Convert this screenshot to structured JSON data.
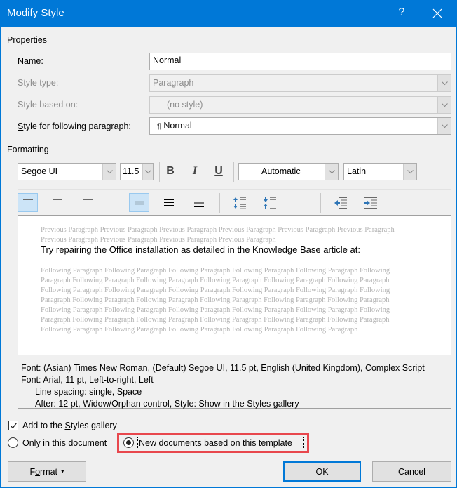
{
  "window": {
    "title": "Modify Style",
    "help_label": "?",
    "close_icon": "close-icon"
  },
  "properties": {
    "group_label": "Properties",
    "name": {
      "label_prefix": "",
      "label_u": "N",
      "label_rest": "ame:",
      "value": "Normal"
    },
    "style_type": {
      "label": "Style type:",
      "value": "Paragraph",
      "disabled": true
    },
    "style_based_on": {
      "label": "Style based on:",
      "value": "(no style)",
      "disabled": true
    },
    "style_following": {
      "label_u": "S",
      "label_rest": "tyle for following paragraph:",
      "icon": "pilcrow-icon",
      "pilcrow": "¶",
      "value": "Normal"
    }
  },
  "formatting": {
    "group_label": "Formatting",
    "font_name": "Segoe UI",
    "font_size": "11.5",
    "bold_label": "B",
    "italic_label": "I",
    "underline_label": "U",
    "color": "Automatic",
    "script": "Latin",
    "alignment": {
      "options": [
        "left",
        "center",
        "right",
        "justify"
      ],
      "selected": "left"
    },
    "line_spacing": {
      "options": [
        "single",
        "one-and-half",
        "double"
      ],
      "selected": "single"
    }
  },
  "preview": {
    "previous_text": "Previous Paragraph Previous Paragraph Previous Paragraph Previous Paragraph Previous Paragraph Previous Paragraph Previous Paragraph Previous Paragraph Previous Paragraph Previous Paragraph",
    "sample_text": "Try repairing the Office installation as detailed in the Knowledge Base article at:",
    "following_text": "Following Paragraph Following Paragraph Following Paragraph Following Paragraph Following Paragraph Following Paragraph Following Paragraph Following Paragraph Following Paragraph Following Paragraph Following Paragraph Following Paragraph Following Paragraph Following Paragraph Following Paragraph Following Paragraph Following Paragraph Following Paragraph Following Paragraph Following Paragraph Following Paragraph Following Paragraph Following Paragraph Following Paragraph Following Paragraph Following Paragraph Following Paragraph Following Paragraph Following Paragraph Following Paragraph Following Paragraph Following Paragraph Following Paragraph Following Paragraph Following Paragraph Following Paragraph Following Paragraph Following Paragraph"
  },
  "description": {
    "lines": [
      "Font: (Asian) Times New Roman, (Default) Segoe UI, 11.5 pt, English (United Kingdom), Complex Script",
      "Font: Arial, 11 pt, Left-to-right, Left",
      "Line spacing:  single, Space",
      "After:  12 pt, Widow/Orphan control, Style: Show in the Styles gallery"
    ]
  },
  "options": {
    "add_to_gallery": {
      "pre": "Add to the ",
      "u": "S",
      "post": "tyles gallery",
      "checked": true
    },
    "only_this_document": {
      "pre": "Only in this ",
      "u": "d",
      "post": "ocument",
      "checked": false
    },
    "new_documents": {
      "label": "New documents based on this template",
      "checked": true
    }
  },
  "buttons": {
    "format": {
      "pre": "F",
      "u": "o",
      "post": "rmat",
      "caret": "▾"
    },
    "ok": "OK",
    "cancel": "Cancel"
  },
  "colors": {
    "titlebar": "#0078d7",
    "highlight": "#e8474d",
    "active_toggle": "#cce4f7"
  }
}
